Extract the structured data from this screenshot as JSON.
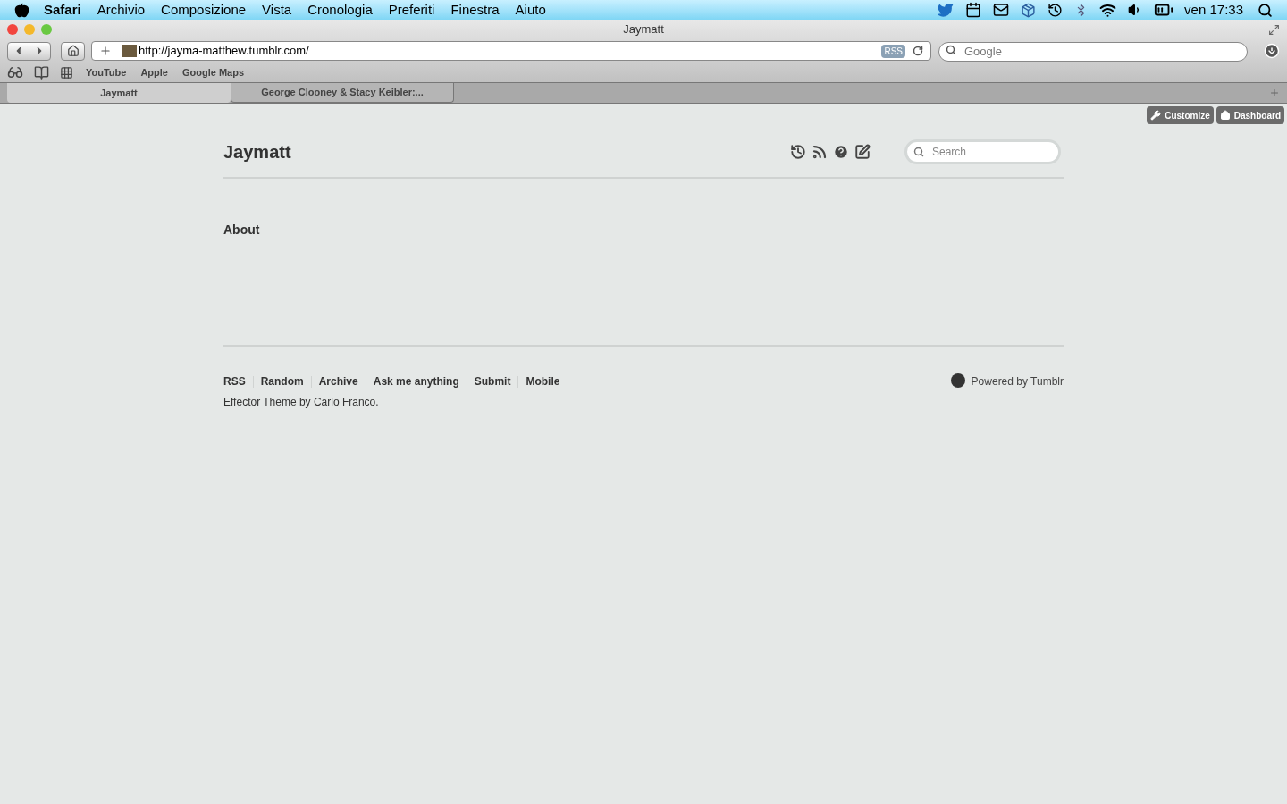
{
  "menubar": {
    "app": "Safari",
    "menus": [
      "Archivio",
      "Composizione",
      "Vista",
      "Cronologia",
      "Preferiti",
      "Finestra",
      "Aiuto"
    ],
    "clock": "ven 17:33"
  },
  "window": {
    "title": "Jaymatt",
    "url": "http://jayma-matthew.tumblr.com/",
    "rss_badge": "RSS",
    "search": {
      "placeholder": "Google"
    }
  },
  "bookmarks": [
    "YouTube",
    "Apple",
    "Google Maps"
  ],
  "tabs": [
    {
      "label": "Jaymatt",
      "selected": true
    },
    {
      "label": "George Clooney & Stacy Keibler:...",
      "selected": false
    }
  ],
  "tumblr_controls": [
    "Customize",
    "Dashboard"
  ],
  "blog": {
    "title": "Jaymatt",
    "search": {
      "placeholder": "Search"
    },
    "page_link": "About",
    "footer_links": [
      "RSS",
      "Random",
      "Archive",
      "Ask me anything",
      "Submit",
      "Mobile"
    ],
    "credit": "Effector Theme by Carlo Franco.",
    "powered_by": "Powered by Tumblr"
  }
}
